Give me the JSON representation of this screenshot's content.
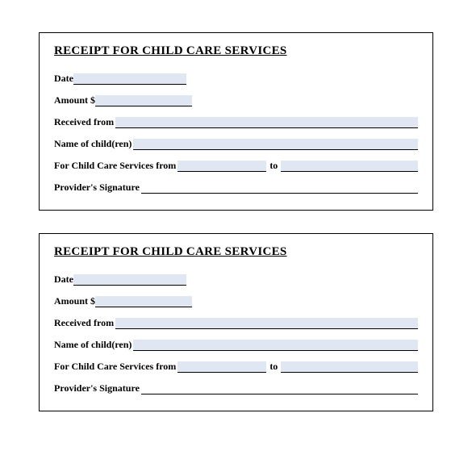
{
  "receipts": [
    {
      "title": "RECEIPT FOR CHILD CARE SERVICES",
      "date_label": "Date",
      "amount_label": "Amount $",
      "received_label": "Received from",
      "child_label": "Name of child(ren)",
      "services_label": "For Child Care Services from",
      "to_label": "to",
      "signature_label": "Provider's Signature"
    },
    {
      "title": "RECEIPT FOR CHILD CARE SERVICES",
      "date_label": "Date",
      "amount_label": "Amount $",
      "received_label": "Received from",
      "child_label": "Name of child(ren)",
      "services_label": "For Child Care Services from",
      "to_label": "to",
      "signature_label": "Provider's Signature"
    }
  ]
}
